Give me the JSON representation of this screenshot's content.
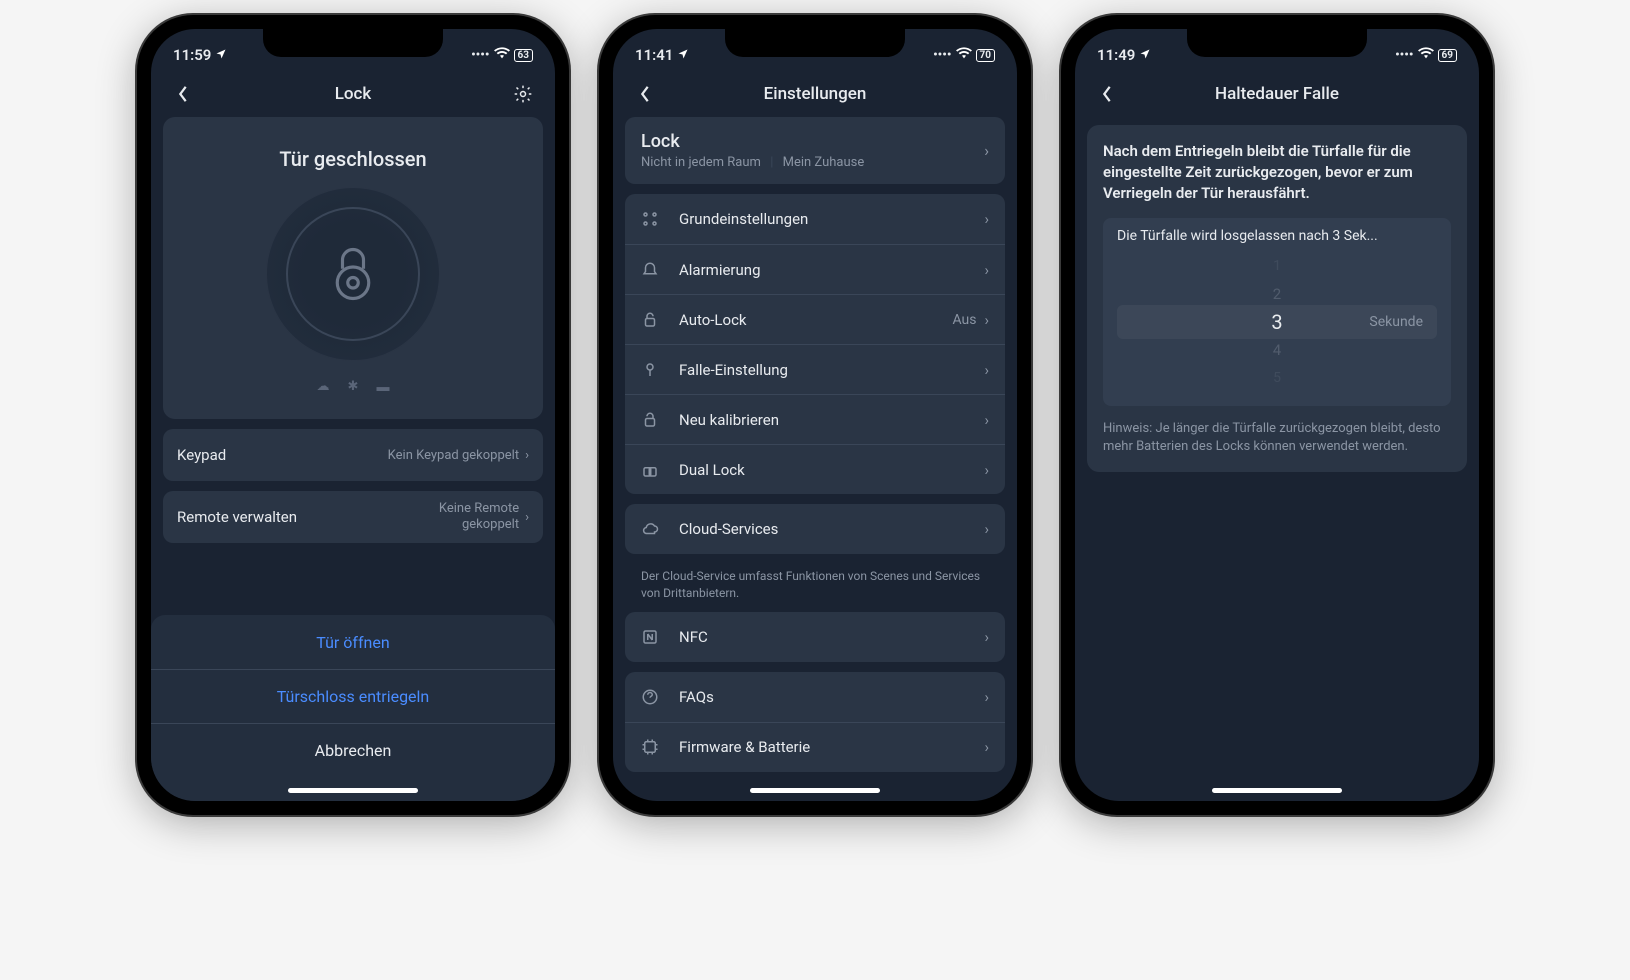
{
  "screen1": {
    "status": {
      "time": "11:59",
      "battery": "63"
    },
    "nav": {
      "title": "Lock"
    },
    "hero": {
      "status": "Tür geschlossen"
    },
    "keypad": {
      "label": "Keypad",
      "trail": "Kein Keypad gekoppelt"
    },
    "remote": {
      "label": "Remote verwalten",
      "trail1": "Keine Remote",
      "trail2": "gekoppelt"
    },
    "sheet": {
      "open": "Tür öffnen",
      "unlock": "Türschloss entriegeln",
      "cancel": "Abbrechen"
    }
  },
  "screen2": {
    "status": {
      "time": "11:41",
      "battery": "70"
    },
    "nav": {
      "title": "Einstellungen"
    },
    "device": {
      "name": "Lock",
      "room": "Nicht in jedem Raum",
      "home": "Mein Zuhause"
    },
    "rows": {
      "basics": "Grundeinstellungen",
      "alarm": "Alarmierung",
      "autolock": "Auto-Lock",
      "autolock_val": "Aus",
      "latch": "Falle-Einstellung",
      "recal": "Neu kalibrieren",
      "dual": "Dual Lock",
      "cloud": "Cloud-Services",
      "cloud_note": "Der Cloud-Service umfasst Funktionen von Scenes und Services von Drittanbietern.",
      "nfc": "NFC",
      "faqs": "FAQs",
      "firmware": "Firmware & Batterie"
    }
  },
  "screen3": {
    "status": {
      "time": "11:49",
      "battery": "69"
    },
    "nav": {
      "title": "Haltedauer Falle"
    },
    "heading": "Nach dem Entriegeln bleibt die Türfalle für die eingestellte Zeit zurückgezogen, bevor er zum Verriegeln der Tür herausfährt.",
    "picker_label": "Die Türfalle wird losgelassen nach 3 Sek...",
    "picker": {
      "v1": "1",
      "v2": "2",
      "v3": "3",
      "v4": "4",
      "v5": "5",
      "unit": "Sekunde"
    },
    "note": "Hinweis: Je länger die Türfalle zurückgezogen bleibt, desto mehr Batterien des Locks können verwendet werden."
  }
}
